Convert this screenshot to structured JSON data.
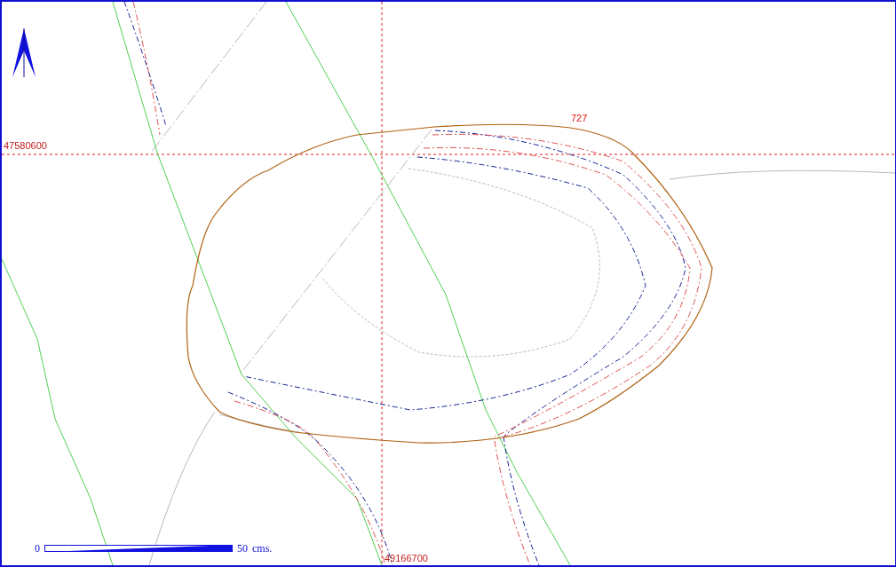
{
  "map": {
    "contour_label": "727",
    "grid": {
      "northing": "47580600",
      "easting": "49166700"
    },
    "scale_bar": {
      "start": "0",
      "end": "50",
      "unit": "cms."
    }
  }
}
